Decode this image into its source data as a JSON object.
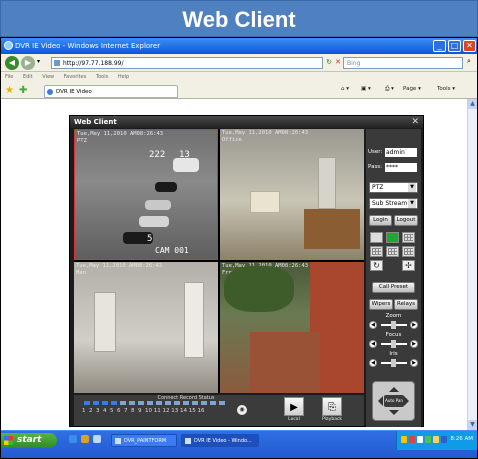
{
  "banner": {
    "title": "Web Client"
  },
  "browser": {
    "window_title": "DVR IE Video - Windows Internet Explorer",
    "address": "http://97.77.188.99/",
    "search_placeholder": "Bing",
    "menu": [
      "File",
      "Edit",
      "View",
      "Favorites",
      "Tools",
      "Help"
    ],
    "tab_label": "DVR IE Video",
    "toolbar": {
      "page": "Page ▾",
      "tools": "Tools ▾"
    }
  },
  "app": {
    "title": "Web Client",
    "cameras": [
      {
        "osd": "Tue,May 11,2010 AM08:26:43\nPTZ"
      },
      {
        "osd": "Tue,May 11,2010 AM08:26:43\nOffice"
      },
      {
        "osd": "Tue,May 11,2010 AM08:26:43\nMan"
      },
      {
        "osd": "Tue,May 11,2010 AM08:26:43\nFront"
      }
    ],
    "cam1_label": "CAM 001",
    "cam1_spots": [
      "222",
      "13",
      "5"
    ],
    "panel": {
      "user_label": "User:",
      "user_value": "admin",
      "pass_label": "Pass:",
      "pass_value": "****",
      "mode": "PTZ",
      "stream": "Sub Stream",
      "login": "Login",
      "logout": "Logout",
      "call_preset": "Call Preset",
      "wipers": "Wipers",
      "relays": "Relays",
      "zoom": "Zoom",
      "focus": "Focus",
      "iris": "Iris",
      "auto_pan": "Auto Pan"
    },
    "status": {
      "label": "Connect Record Status",
      "numbers": "1  2  3  4  5  6  7  8  9  10 11 12 13 14 15 16"
    },
    "local_label": "Local",
    "playback_label": "Playback"
  },
  "taskbar": {
    "start": "start",
    "tasks": [
      "DVR_PAINTFORM",
      "DVR IE Video - Windo..."
    ],
    "clock": "8:26 AM"
  }
}
